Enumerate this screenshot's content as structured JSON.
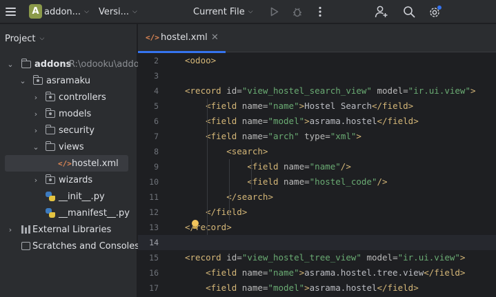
{
  "toolbar": {
    "project_badge": "A",
    "project_name": "addon...",
    "vcs_label": "Versi...",
    "run_config": "Current File"
  },
  "project_panel": {
    "title": "Project",
    "tree": [
      {
        "label": "addons",
        "hint": "R:\\odooku\\addo",
        "kind": "folder",
        "expanded": true
      },
      {
        "label": "asramaku",
        "kind": "package",
        "expanded": true
      },
      {
        "label": "controllers",
        "kind": "package",
        "expanded": false
      },
      {
        "label": "models",
        "kind": "package",
        "expanded": false
      },
      {
        "label": "security",
        "kind": "folder",
        "expanded": false
      },
      {
        "label": "views",
        "kind": "folder",
        "expanded": true
      },
      {
        "label": "hostel.xml",
        "kind": "xml",
        "selected": true
      },
      {
        "label": "wizards",
        "kind": "package",
        "expanded": false
      },
      {
        "label": "__init__.py",
        "kind": "python"
      },
      {
        "label": "__manifest__.py",
        "kind": "python"
      },
      {
        "label": "External Libraries",
        "kind": "library",
        "expanded": false
      },
      {
        "label": "Scratches and Consoles",
        "kind": "scratch"
      }
    ]
  },
  "editor": {
    "active_tab": "hostel.xml",
    "tab_icon": "</>",
    "current_line": 14,
    "lines": [
      {
        "n": "2",
        "code": "<odoo>"
      },
      {
        "n": "3",
        "code": ""
      },
      {
        "n": "4",
        "code": "<record id=\"view_hostel_search_view\" model=\"ir.ui.view\">"
      },
      {
        "n": "5",
        "code": "    <field name=\"name\">Hostel Search</field>"
      },
      {
        "n": "6",
        "code": "    <field name=\"model\">asrama.hostel</field>"
      },
      {
        "n": "7",
        "code": "    <field name=\"arch\" type=\"xml\">"
      },
      {
        "n": "8",
        "code": "        <search>"
      },
      {
        "n": "9",
        "code": "            <field name=\"name\"/>"
      },
      {
        "n": "10",
        "code": "            <field name=\"hostel_code\"/>"
      },
      {
        "n": "11",
        "code": "        </search>"
      },
      {
        "n": "12",
        "code": "    </field>"
      },
      {
        "n": "13",
        "code": "</record>"
      },
      {
        "n": "14",
        "code": ""
      },
      {
        "n": "15",
        "code": "<record id=\"view_hostel_tree_view\" model=\"ir.ui.view\">"
      },
      {
        "n": "16",
        "code": "    <field name=\"name\">asrama.hostel.tree.view</field>"
      },
      {
        "n": "17",
        "code": "    <field name=\"model\">asrama.hostel</field>"
      }
    ]
  },
  "colors": {
    "accent": "#3574f0",
    "xml_tag": "#d5b778",
    "xml_attr_value": "#6aab73",
    "project_badge": "#8b9a4a"
  }
}
